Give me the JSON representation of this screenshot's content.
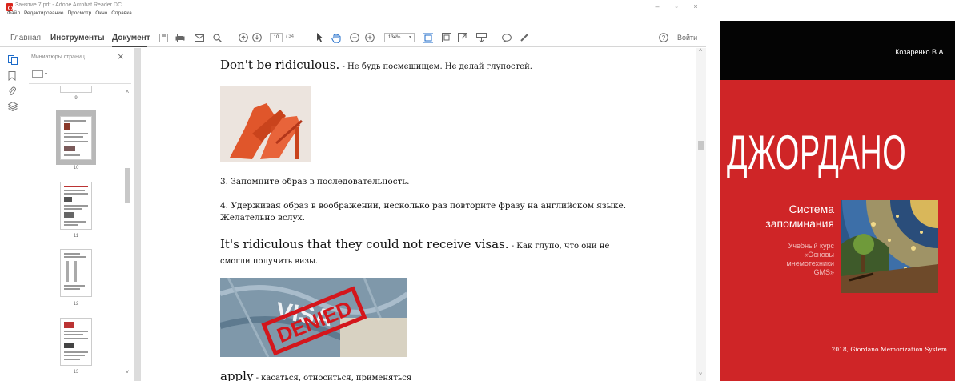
{
  "window": {
    "title": "Занятие 7.pdf - Adobe Acrobat Reader DC",
    "menu": [
      "Файл",
      "Редактирование",
      "Просмотр",
      "Окно",
      "Справка"
    ]
  },
  "toolbar": {
    "tabs": [
      "Главная",
      "Инструменты",
      "Документ"
    ],
    "page_current": "10",
    "page_total": "/ 34",
    "zoom": "134%",
    "sign_in": "Войти"
  },
  "thumbnails": {
    "title": "Миниатюры страниц",
    "pages": [
      "9",
      "10",
      "11",
      "12",
      "13"
    ],
    "selected": "10"
  },
  "document": {
    "line1_en": "Don't be ridiculous.",
    "line1_ru": " - Не будь посмешищем. Не делай глупостей.",
    "step3": "3. Запомните образ в последовательность.",
    "step4": "4. Удерживая образ в воображении, несколько раз повторите фразу на английском языке. Желательно вслух.",
    "line2_en": "It's ridiculous that they could not receive visas.",
    "line2_ru": " - Как глупо, что они не смогли получить визы.",
    "line3_en": "apply",
    "line3_ru": " - касаться, относиться, применяться",
    "visa_stamp": "DENIED",
    "visa_word": "VISA"
  },
  "cover": {
    "author": "Козаренко В.А.",
    "title": "ДЖОРДАНО",
    "subtitle_line1": "Система",
    "subtitle_line2": "запоминания",
    "course_line1": "Учебный курс",
    "course_line2": "«Основы",
    "course_line3": "мнемотехники",
    "course_line4": "GMS»",
    "footer": "2018, Giordano Memorization System",
    "colors": {
      "red": "#cf2527",
      "black": "#040404"
    }
  }
}
